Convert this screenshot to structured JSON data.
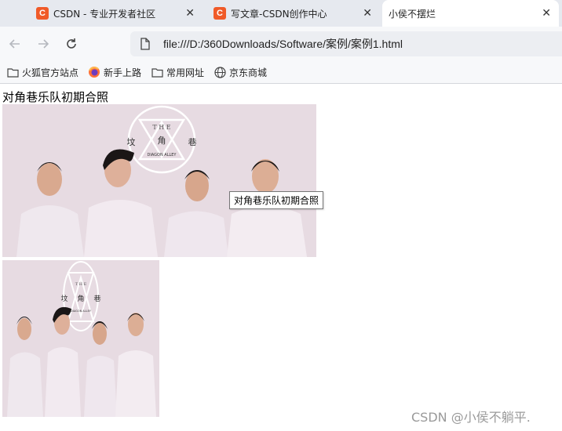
{
  "tabs": [
    {
      "title": "CSDN - 专业开发者社区",
      "favicon": "C",
      "active": false
    },
    {
      "title": "写文章-CSDN创作中心",
      "favicon": "C",
      "active": false
    },
    {
      "title": "小侯不摆烂",
      "favicon": "",
      "active": true
    }
  ],
  "address": {
    "url": "file:///D:/360Downloads/Software/案例/案例1.html"
  },
  "bookmarks": [
    {
      "label": "火狐官方站点",
      "icon": "folder-icon"
    },
    {
      "label": "新手上路",
      "icon": "firefox-icon"
    },
    {
      "label": "常用网址",
      "icon": "folder-icon"
    },
    {
      "label": "京东商城",
      "icon": "globe-icon"
    }
  ],
  "page": {
    "caption": "对角巷乐队初期合照",
    "tooltip": "对角巷乐队初期合照",
    "logo": {
      "top_letters": "T H E",
      "left": "坟",
      "middle": "角",
      "right": "巷",
      "bottom": "DIAGON ALLEY"
    }
  },
  "watermark": "CSDN @小侯不躺平.",
  "colors": {
    "accent": "#f05a28",
    "photo_bg": "#e6d8df"
  }
}
